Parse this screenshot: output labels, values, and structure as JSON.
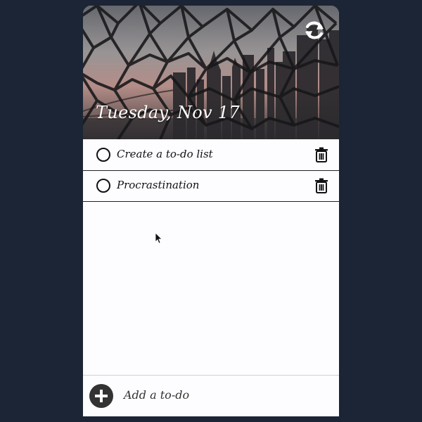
{
  "header": {
    "date_label": "Tuesday, Nov 17",
    "refresh_icon": "refresh-icon"
  },
  "todos": [
    {
      "text": "Create a to-do list",
      "completed": false
    },
    {
      "text": "Procrastination",
      "completed": false
    }
  ],
  "footer": {
    "add_label": "Add a to-do",
    "add_icon": "plus-icon"
  },
  "colors": {
    "background": "#1b2535",
    "card": "#fdfcff",
    "text": "#111111",
    "add_button": "#333333"
  }
}
